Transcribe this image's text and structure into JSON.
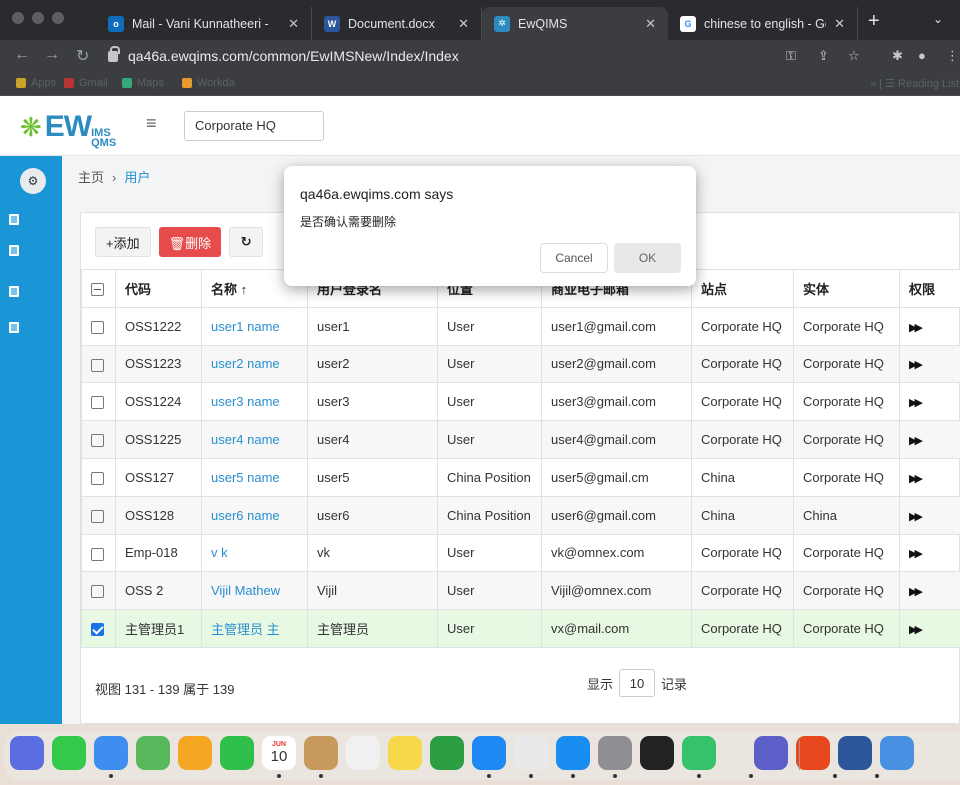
{
  "browser": {
    "tabs": [
      {
        "title": "Mail - Vani Kunnatheeri -",
        "favicon": "outlook-icon",
        "color": "#0f6cbd"
      },
      {
        "title": "Document.docx",
        "favicon": "word-icon",
        "color": "#2b579a"
      },
      {
        "title": "EwQIMS",
        "favicon": "ewqims-icon",
        "color": "#2c8bbf"
      },
      {
        "title": "chinese to english - Goo(",
        "favicon": "google-icon",
        "color": "#ffffff"
      }
    ],
    "url": "qa46a.ewqims.com/common/EwIMSNew/Index/Index",
    "bookmarks": [
      "Apps",
      "Gmail",
      "Maps",
      "Workda"
    ],
    "reading_list": "Reading List"
  },
  "app": {
    "logo_word": "EW",
    "logo_sub_top": "IMS",
    "logo_sub_bottom": "QMS",
    "site": "Corporate HQ",
    "breadcrumb": {
      "home": "主页",
      "current": "用户"
    },
    "actions": {
      "add": "+添加",
      "delete": "🗑删除",
      "refresh": "↻"
    },
    "table": {
      "headers": [
        "代码",
        "名称 ↑",
        "用户登录名",
        "位置",
        "商业电子邮箱",
        "站点",
        "实体",
        "权限"
      ],
      "rows": [
        {
          "code": "OSS1222",
          "name": "user1 name",
          "login": "user1",
          "position": "User",
          "email": "user1@gmail.com",
          "site": "Corporate HQ",
          "entity": "Corporate HQ",
          "checked": false
        },
        {
          "code": "OSS1223",
          "name": "user2 name",
          "login": "user2",
          "position": "User",
          "email": "user2@gmail.com",
          "site": "Corporate HQ",
          "entity": "Corporate HQ",
          "checked": false
        },
        {
          "code": "OSS1224",
          "name": "user3 name",
          "login": "user3",
          "position": "User",
          "email": "user3@gmail.com",
          "site": "Corporate HQ",
          "entity": "Corporate HQ",
          "checked": false
        },
        {
          "code": "OSS1225",
          "name": "user4 name",
          "login": "user4",
          "position": "User",
          "email": "user4@gmail.com",
          "site": "Corporate HQ",
          "entity": "Corporate HQ",
          "checked": false
        },
        {
          "code": "OSS127",
          "name": "user5 name",
          "login": "user5",
          "position": "China Position",
          "email": "user5@gmail.cm",
          "site": "China",
          "entity": "Corporate HQ",
          "checked": false
        },
        {
          "code": "OSS128",
          "name": "user6 name",
          "login": "user6",
          "position": "China Position",
          "email": "user6@gmail.com",
          "site": "China",
          "entity": "China",
          "checked": false
        },
        {
          "code": "Emp-018",
          "name": "v k",
          "login": "vk",
          "position": "User",
          "email": "vk@omnex.com",
          "site": "Corporate HQ",
          "entity": "Corporate HQ",
          "checked": false
        },
        {
          "code": "OSS 2",
          "name": "Vijil Mathew",
          "login": "Vijil",
          "position": "User",
          "email": "Vijil@omnex.com",
          "site": "Corporate HQ",
          "entity": "Corporate HQ",
          "checked": false
        },
        {
          "code": "主管理员1",
          "name": "主管理员 主",
          "login": "主管理员",
          "position": "User",
          "email": "vx@mail.com",
          "site": "Corporate HQ",
          "entity": "Corporate HQ",
          "checked": true
        }
      ]
    },
    "footer": {
      "summary": "视图 131 - 139 属于 139",
      "show_label": "显示",
      "page_size": "10",
      "records_label": "记录"
    }
  },
  "dialog": {
    "title": "qa46a.ewqims.com says",
    "message": "是否确认需要删除",
    "cancel": "Cancel",
    "ok": "OK"
  },
  "dock": {
    "calendar_month": "JUN",
    "calendar_day": "10",
    "apps": [
      {
        "name": "launchpad-icon",
        "color": "#5b6ee1"
      },
      {
        "name": "messages-icon",
        "color": "#33c94a"
      },
      {
        "name": "mail-icon",
        "color": "#3d8ef0"
      },
      {
        "name": "maps-icon",
        "color": "#58b85c"
      },
      {
        "name": "photos-icon",
        "color": "#f5a623"
      },
      {
        "name": "facetime-icon",
        "color": "#2fbf4b"
      },
      {
        "name": "calendar-icon",
        "color": "#ffffff"
      },
      {
        "name": "contacts-icon",
        "color": "#c79a5c"
      },
      {
        "name": "reminders-icon",
        "color": "#f0f0f0"
      },
      {
        "name": "notes-icon",
        "color": "#f7d84b"
      },
      {
        "name": "numbers-icon",
        "color": "#2e9e45"
      },
      {
        "name": "app-store-icon",
        "color": "#1e88f5"
      },
      {
        "name": "chrome-icon",
        "color": "#e9e9e9"
      },
      {
        "name": "safari-icon",
        "color": "#1a8df0"
      },
      {
        "name": "system-prefs-icon",
        "color": "#8e8e93"
      },
      {
        "name": "terminal-icon",
        "color": "#222222"
      },
      {
        "name": "find-my-icon",
        "color": "#35c26b"
      },
      {
        "name": "teams-icon",
        "color": "#5b5fc7"
      },
      {
        "name": "office-icon",
        "color": "#e8481d"
      },
      {
        "name": "word-icon",
        "color": "#2b579a"
      },
      {
        "name": "finder-icon",
        "color": "#4a90e2"
      }
    ]
  }
}
